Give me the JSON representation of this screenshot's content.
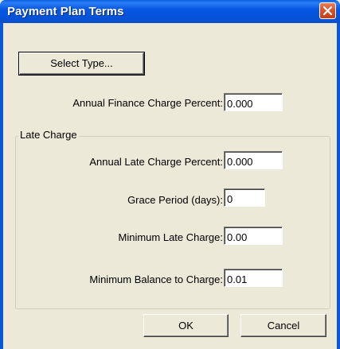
{
  "window": {
    "title": "Payment Plan Terms",
    "close_label": "Close"
  },
  "select_type_button": "Select Type...",
  "annual_finance": {
    "label": "Annual Finance Charge Percent:",
    "value": "0.000"
  },
  "late_charge": {
    "group_label": "Late Charge",
    "annual_late": {
      "label": "Annual Late Charge Percent:",
      "value": "0.000"
    },
    "grace_period": {
      "label": "Grace Period (days):",
      "value": "0"
    },
    "minimum_late": {
      "label": "Minimum Late Charge:",
      "value": "0.00"
    },
    "minimum_balance": {
      "label": "Minimum Balance to Charge:",
      "value": "0.01"
    }
  },
  "buttons": {
    "ok": "OK",
    "cancel": "Cancel"
  },
  "colors": {
    "titlebar": "#0757e3",
    "face": "#ece9d8",
    "close_button": "#d9542a"
  }
}
